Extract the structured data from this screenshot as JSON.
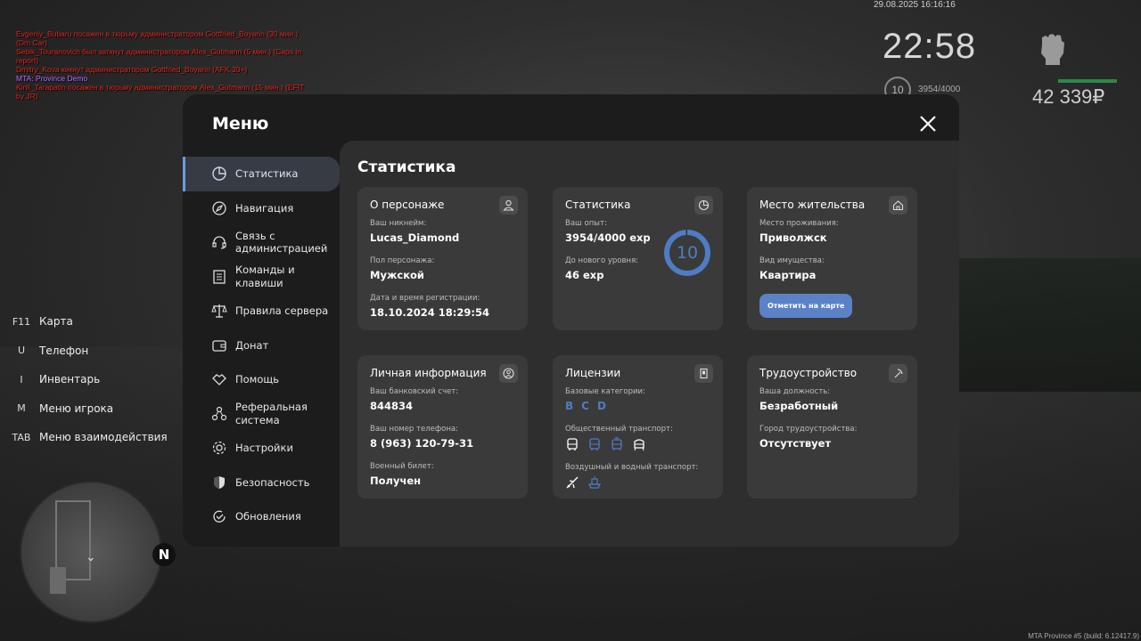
{
  "chat": [
    "Evgeniy_Bubaru посажен в тюрьму администратором Gottfried_Boyarin (30 мин.) (Dm Car)",
    "Sebik_Touranovich был заткнут администратором Alex_Gutmann (5 мин.) (Caps in report)",
    "Dmitry_Kova кикнут администратором Gottfried_Boyarin (AFK 30+)",
    "MTA: Province Demo",
    "Kirill_Tarapatin посажен в тюрьму администратором Alex_Gutmann (15 мин.) (EFIT by JR)"
  ],
  "hud": {
    "datetime": "29.08.2025 16:16:16",
    "time": "22:58",
    "level": "10",
    "exp": "3954/4000",
    "money": "42 339₽"
  },
  "hints": [
    {
      "key": "F11",
      "label": "Карта"
    },
    {
      "key": "U",
      "label": "Телефон"
    },
    {
      "key": "I",
      "label": "Инвентарь"
    },
    {
      "key": "M",
      "label": "Меню игрока"
    },
    {
      "key": "TAB",
      "label": "Меню взаимодействия"
    }
  ],
  "compass": "N",
  "footer": "MTA Province #5 (build: 6.12417.9)",
  "menu": {
    "title": "Меню",
    "nav": [
      {
        "label": "Статистика",
        "icon": "pie-chart-icon"
      },
      {
        "label": "Навигация",
        "icon": "compass-icon"
      },
      {
        "label": "Связь с\nадминистрацией",
        "icon": "headset-icon"
      },
      {
        "label": "Команды и\nклавиши",
        "icon": "document-icon"
      },
      {
        "label": "Правила сервера",
        "icon": "scales-icon"
      },
      {
        "label": "Донат",
        "icon": "wallet-icon"
      },
      {
        "label": "Помощь",
        "icon": "handshake-icon"
      },
      {
        "label": "Реферальная\nсистема",
        "icon": "share-nodes-icon"
      },
      {
        "label": "Настройки",
        "icon": "gear-icon"
      },
      {
        "label": "Безопасность",
        "icon": "shield-icon"
      },
      {
        "label": "Обновления",
        "icon": "refresh-check-icon"
      }
    ]
  },
  "content": {
    "title": "Статистика",
    "character": {
      "title": "О персонаже",
      "nickname_label": "Ваш никнейм:",
      "nickname": "Lucas_Diamond",
      "gender_label": "Пол персонажа:",
      "gender": "Мужской",
      "reg_label": "Дата и время регистрации:",
      "reg": "18.10.2024 18:29:54"
    },
    "stats": {
      "title": "Статистика",
      "exp_label": "Ваш опыт:",
      "exp": "3954/4000 exp",
      "next_label": "До нового уровня:",
      "next": "46 exp",
      "level": "10",
      "progress": 0.9885
    },
    "residence": {
      "title": "Место жительства",
      "place_label": "Место проживания:",
      "place": "Приволжск",
      "property_label": "Вид имущества:",
      "property": "Квартира",
      "button": "Отметить на карте"
    },
    "personal": {
      "title": "Личная информация",
      "bank_label": "Ваш банковский счет:",
      "bank": "844834",
      "phone_label": "Ваш номер телефона:",
      "phone": "8 (963) 120-79-31",
      "military_label": "Военный билет:",
      "military": "Получен"
    },
    "licenses": {
      "title": "Лицензии",
      "basic_label": "Базовые категории:",
      "categories": [
        "B",
        "C",
        "D"
      ],
      "public_label": "Общественный транспорт:",
      "public_icons": [
        "bus-icon",
        "trolleybus-icon",
        "tram-icon",
        "metro-icon"
      ],
      "air_label": "Воздушный и водный транспорт:",
      "air_icons": [
        "plane-icon",
        "boat-icon"
      ]
    },
    "employment": {
      "title": "Трудоустройство",
      "position_label": "Ваша должность:",
      "position": "Безработный",
      "city_label": "Город трудоустройства:",
      "city": "Отсутствует"
    }
  }
}
